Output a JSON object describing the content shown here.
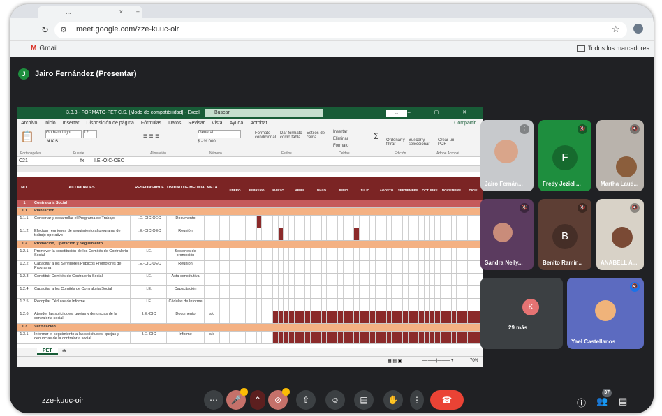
{
  "browser": {
    "tab_title": "...",
    "url": "meet.google.com/zze-kuuc-oir",
    "bookmark_gmail": "Gmail",
    "bookmark_all": "Todos los marcadores"
  },
  "meet": {
    "presenter_initial": "J",
    "presenter_label": "Jairo Fernández (Presentar)",
    "meeting_code": "zze-kuuc-oir",
    "participants_count": "37",
    "mic_badge": "!",
    "cam_badge": "!",
    "tiles": [
      {
        "name": "Jairo Fernán...",
        "initial": ""
      },
      {
        "name": "Fredy Jeziel ...",
        "initial": "F"
      },
      {
        "name": "Martha Laud...",
        "initial": ""
      },
      {
        "name": "Sandra Nelly...",
        "initial": ""
      },
      {
        "name": "Benito Ramír...",
        "initial": "B"
      },
      {
        "name": "ANABELL A...",
        "initial": ""
      },
      {
        "name": "29 más",
        "initial": "K"
      },
      {
        "name": "Yael Castellanos",
        "initial": ""
      }
    ]
  },
  "excel": {
    "title": "3.3.3 - FORMATO-PET-C.S. [Modo de compatibilidad] - Excel",
    "search_placeholder": "Buscar",
    "menu": [
      "Archivo",
      "Inicio",
      "Insertar",
      "Disposición de página",
      "Fórmulas",
      "Datos",
      "Revisar",
      "Vista",
      "Ayuda",
      "Acrobat"
    ],
    "share": "Compartir",
    "font_name": "Gotham Light",
    "font_size": "12",
    "number_format": "General",
    "ribbon_groups": [
      "Portapapeles",
      "Fuente",
      "Alineación",
      "Número",
      "Estilos",
      "Celdas",
      "Edición",
      "Adobe Acrobat"
    ],
    "ribbon_buttons": [
      "Formato condicional",
      "Dar formato como tabla",
      "Estilos de celda",
      "Insertar",
      "Eliminar",
      "Formato",
      "Ordenar y filtrar",
      "Buscar y seleccionar",
      "Crear un PDF"
    ],
    "cell_ref": "C21",
    "formula": "I.E.-OIC-OEC",
    "headers": {
      "num": "NO.",
      "act": "ACTIVIDADES",
      "resp": "RESPONSABLE",
      "unit": "UNIDAD DE MEDIDA",
      "meta": "META"
    },
    "months": [
      "ENERO",
      "FEBRERO",
      "MARZO",
      "ABRIL",
      "MAYO",
      "JUNIO",
      "JULIO",
      "AGOSTO",
      "SEPTIEMBRE",
      "OCTUBRE",
      "NOVIEMBRE",
      "DICIE"
    ],
    "rows": [
      {
        "type": "main",
        "num": "1",
        "act": "Contraloría Social"
      },
      {
        "type": "sec",
        "num": "1.1",
        "act": "Planeación"
      },
      {
        "type": "data",
        "num": "1.1.1",
        "act": "Concertar y desarrollar el Programa de Trabajo",
        "resp": "I.E.-OIC-OEC",
        "unit": "Documento",
        "meta": ""
      },
      {
        "type": "data",
        "num": "1.1.2",
        "act": "Efectuar reuniones de seguimiento al programa de trabajo operativo",
        "resp": "I.E.-OIC-OEC",
        "unit": "Reunión",
        "meta": ""
      },
      {
        "type": "sec",
        "num": "1.2",
        "act": "Promoción, Operación y Seguimiento"
      },
      {
        "type": "data",
        "num": "1.2.1",
        "act": "Promover la constitución de los Comités de Contraloría Social",
        "resp": "I.E.",
        "unit": "Sesiones de promoción",
        "meta": ""
      },
      {
        "type": "data",
        "num": "1.2.2",
        "act": "Capacitar a los Servidores Públicos Promotores de Programa",
        "resp": "I.E.-OIC-OEC",
        "unit": "Reunión",
        "meta": ""
      },
      {
        "type": "data",
        "num": "1.2.3",
        "act": "Constituir Comités de Contraloría Social",
        "resp": "I.E.",
        "unit": "Acta constitutiva",
        "meta": ""
      },
      {
        "type": "data",
        "num": "1.2.4",
        "act": "Capacitar a los Comités de Contraloría Social",
        "resp": "I.E.",
        "unit": "Capacitación",
        "meta": ""
      },
      {
        "type": "data",
        "num": "1.2.5",
        "act": "Recopilar Cédulas de Informe",
        "resp": "I.E.",
        "unit": "Cédulas de Informe",
        "meta": ""
      },
      {
        "type": "data",
        "num": "1.2.6",
        "act": "Atender las solicitudes, quejas y denuncias de la contraloría social",
        "resp": "I.E.-OIC",
        "unit": "Documento",
        "meta": "s/c"
      },
      {
        "type": "sec",
        "num": "1.3",
        "act": "Verificación"
      },
      {
        "type": "data",
        "num": "1.3.1",
        "act": "Informar el seguimiento a las solicitudes, quejas y denuncias de la contraloría social",
        "resp": "I.E.-OIC",
        "unit": "Informe",
        "meta": "s/c"
      }
    ],
    "sheet_tab": "PET",
    "zoom": "70%"
  },
  "colors": {
    "excel_green": "#185c37",
    "header_maroon": "#7b2424",
    "section_orange": "#f4b183",
    "meet_bg": "#202124",
    "hangup": "#ea4335"
  }
}
